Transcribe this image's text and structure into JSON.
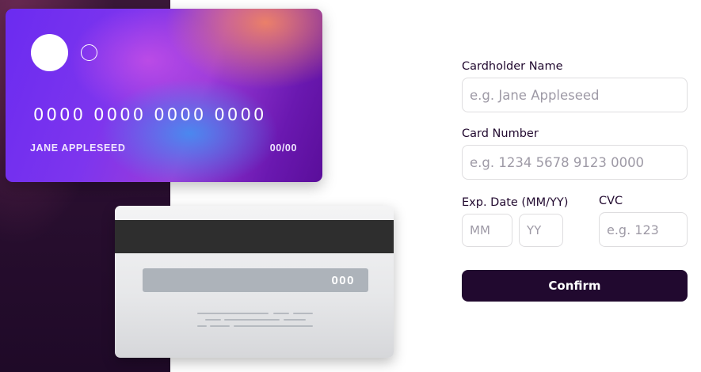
{
  "card_front": {
    "number": "0000 0000 0000 0000",
    "name": "JANE APPLESEED",
    "expiry": "00/00"
  },
  "card_back": {
    "cvc": "000"
  },
  "form": {
    "cardholder_label": "Cardholder Name",
    "cardholder_placeholder": "e.g. Jane Appleseed",
    "number_label": "Card Number",
    "number_placeholder": "e.g. 1234 5678 9123 0000",
    "exp_label": "Exp. Date (MM/YY)",
    "month_placeholder": "MM",
    "year_placeholder": "YY",
    "cvc_label": "CVC",
    "cvc_placeholder": "e.g. 123",
    "confirm_label": "Confirm"
  },
  "colors": {
    "dark_violet": "#21092f",
    "input_border": "#dedddf",
    "placeholder": "#9e9aa6"
  }
}
